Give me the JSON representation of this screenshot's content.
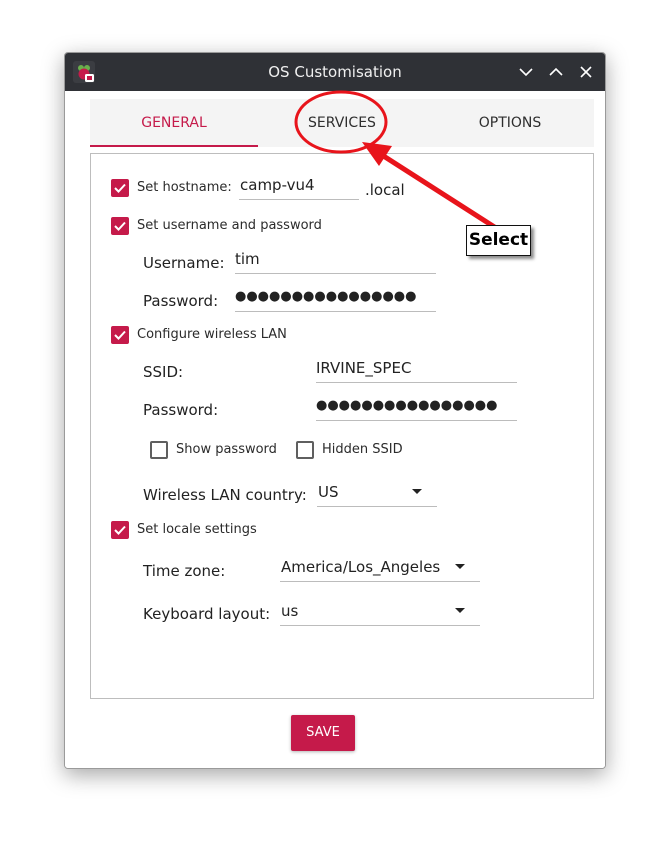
{
  "window": {
    "title": "OS Customisation",
    "icon": "raspberry-pi-icon",
    "controls": [
      "minimize-icon",
      "maximize-icon",
      "close-icon"
    ]
  },
  "tabs": [
    {
      "label": "GENERAL",
      "active": true
    },
    {
      "label": "SERVICES",
      "active": false
    },
    {
      "label": "OPTIONS",
      "active": false
    }
  ],
  "general": {
    "hostname": {
      "checked": true,
      "label": "Set hostname:",
      "value": "camp-vu4",
      "suffix": ".local"
    },
    "user": {
      "checked": true,
      "label": "Set username and password",
      "username_label": "Username:",
      "username_value": "tim",
      "password_label": "Password:",
      "password_value": "●●●●●●●●●●●●●●●●"
    },
    "wifi": {
      "checked": true,
      "label": "Configure wireless LAN",
      "ssid_label": "SSID:",
      "ssid_value": "IRVINE_SPEC",
      "password_label": "Password:",
      "password_value": "●●●●●●●●●●●●●●●●",
      "show_password": {
        "checked": false,
        "label": "Show password"
      },
      "hidden_ssid": {
        "checked": false,
        "label": "Hidden SSID"
      },
      "country_label": "Wireless LAN country:",
      "country_value": "US"
    },
    "locale": {
      "checked": true,
      "label": "Set locale settings",
      "timezone_label": "Time zone:",
      "timezone_value": "America/Los_Angeles",
      "keyboard_label": "Keyboard layout:",
      "keyboard_value": "us"
    }
  },
  "save_label": "SAVE",
  "annotation": {
    "text": "Select",
    "color": "#e8141b"
  },
  "colors": {
    "accent": "#c51a4a",
    "titlebar": "#2f3136"
  }
}
